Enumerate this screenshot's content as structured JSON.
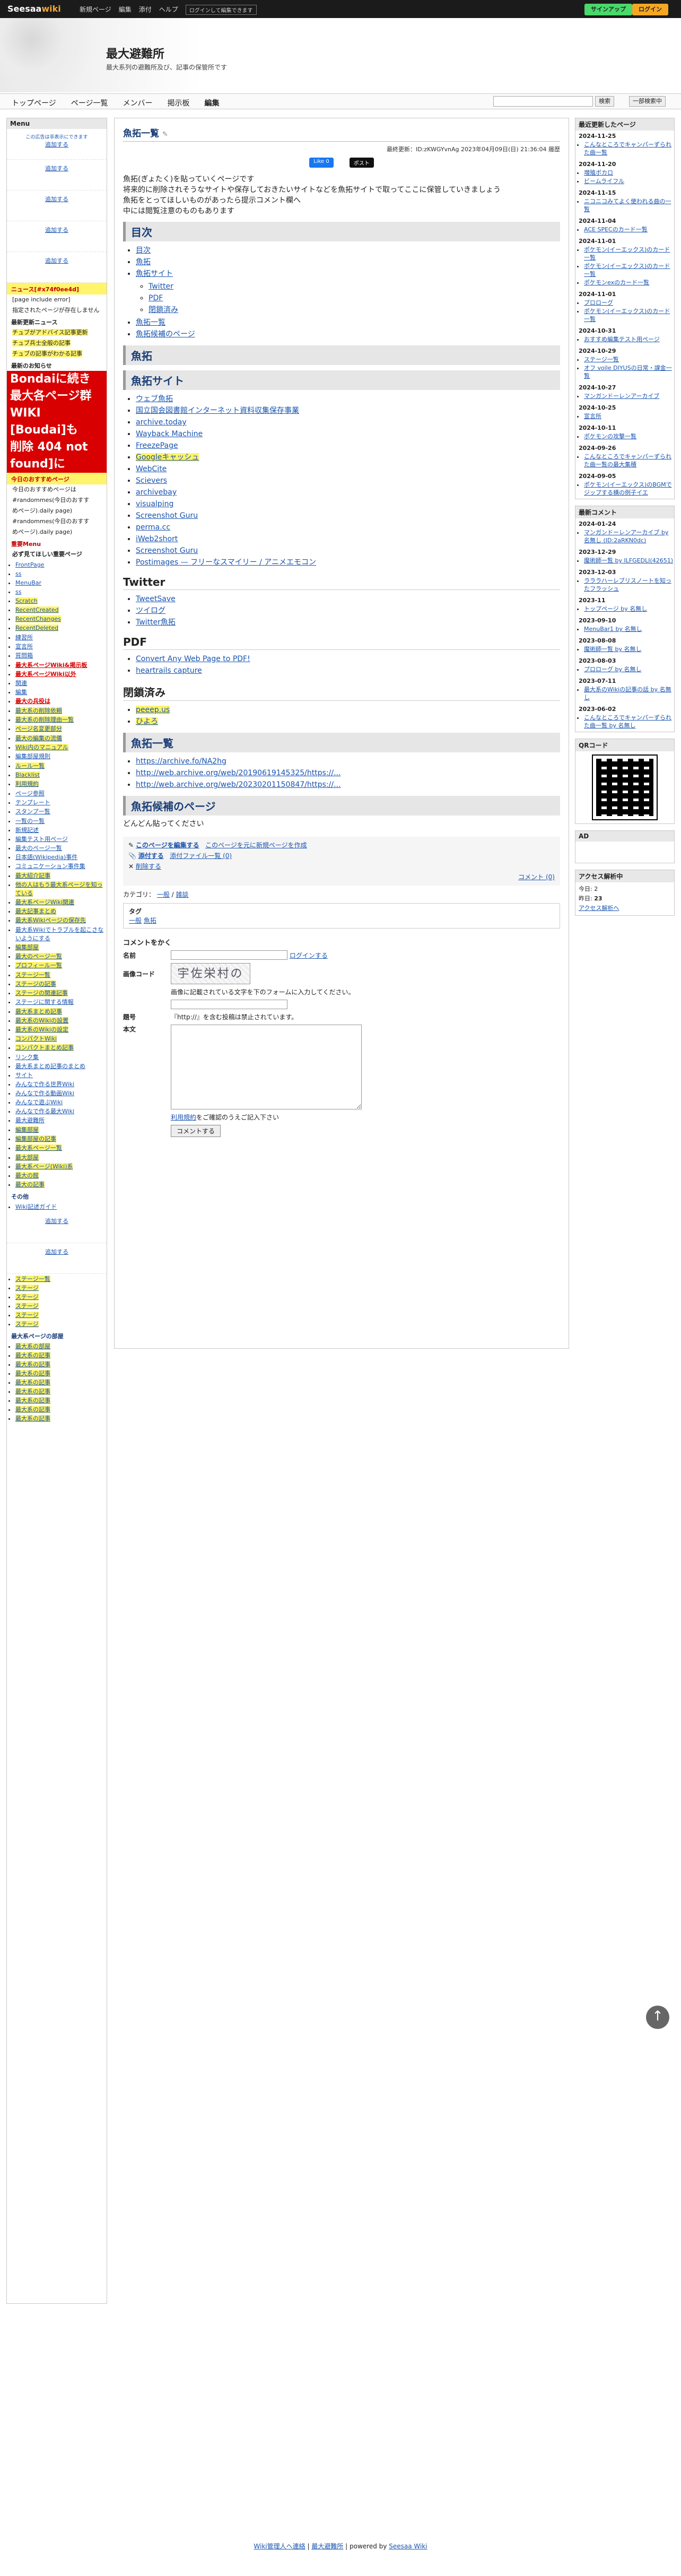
{
  "topbar": {
    "logo_main": "Seesaa",
    "logo_wiki": "wiki",
    "nav": [
      "新規ページ",
      "編集",
      "添付",
      "ヘルプ"
    ],
    "hint": "ログインして編集できます",
    "btn_signup": "サインアップ",
    "btn_login": "ログイン"
  },
  "header": {
    "title": "最大避難所",
    "subtitle": "最大系列の避難所及び、記事の保管所です"
  },
  "gnav": {
    "items": [
      "トップページ",
      "ページ一覧",
      "メンバー",
      "掲示板",
      "編集"
    ],
    "search_btn": "検索",
    "search_btn2": "一部検索中"
  },
  "left": {
    "menu_title": "Menu",
    "ad_text": "この広告は非表示にできます",
    "add_link": "追加する",
    "news_title": "ニュース[#x74f0ee4d]",
    "news_lines": [
      "[page include error]",
      "指定されたページが存在しません"
    ],
    "update_title": "最新更新ニュース",
    "yellow_lines": [
      "チュブがアドバイス記事更新",
      "チュブ兵士全般の記事",
      "チュブの記事がわかる記事"
    ],
    "notice_title": "最新のお知らせ",
    "red_big": [
      "Bondaiに続き",
      "最大各ページ群",
      "WIKI",
      "[Boudai]も",
      "削除 404 not",
      "found]に"
    ],
    "recommend_title": "今日のおすすめページ",
    "recommend": [
      "今日のおすすめページは",
      "#randommes(今日のおすす",
      "めページ).daily page)",
      "#randommes(今日のおすす",
      "めページ).daily page)"
    ],
    "important_title": "重要Menu",
    "important_sub": "必ず見てほしい重要ページ",
    "links1": [
      "FrontPage",
      "ss",
      "MenuBar",
      "ss",
      "Scratch",
      "RecentCreated",
      "RecentChanges",
      "RecentDeleted"
    ],
    "links2": [
      "練習所",
      "宣言所",
      "質問箱"
    ],
    "links3": [
      "最大系ページWiki&掲示板",
      "最大系ページWiki以外",
      "関連",
      "編集",
      "最大の兵役は"
    ],
    "links4": [
      "最大系の削除依頼",
      "最大系の削除理由一覧",
      "ページ名変更部分"
    ],
    "links5": [
      "最大の編集の流儀",
      "Wiki内のマニュアル",
      "編集部屋規則"
    ],
    "links6": [
      "ルール一覧",
      "Blacklist",
      "利用規約"
    ],
    "links7": [
      "ページ参照",
      "テンプレート",
      "スタンプ一覧"
    ],
    "links8": [
      "一覧の一覧",
      "新規記述",
      "編集テスト用ページ",
      "最大のページ一覧",
      "日本語(Wikipedia)事件",
      "コミュニケーション事件集"
    ],
    "links9": [
      "最大紹介記事",
      "他の人はもう最大系ページを知っている",
      "最大系ページWiki関連",
      "最大記事まとめ",
      "最大系Wikiページの保存先"
    ],
    "links10": [
      "最大系Wikiでトラブルを起こさないようにする",
      "編集部屋",
      "最大のページ一覧",
      "プロフィール一覧"
    ],
    "links11": [
      "ステージ一覧",
      "ステージの記事",
      "ステージの関連記事",
      "ステージに関する情報"
    ],
    "links12": [
      "最大系まとめ記事",
      "最大系のWikiの設置",
      "最大系のWikiの設定",
      "コンパクトWiki",
      "コンパクトまとめ記事"
    ],
    "links13": [
      "リンク集",
      "最大系まとめ記事のまとめ",
      "サイト",
      "みんなで作る世界Wiki",
      "みんなで作る動画Wiki",
      "みんなで遊ぶWiki",
      "みんなで作る最大Wiki",
      "最大避難所"
    ],
    "links14": [
      "編集部屋",
      "編集部屋の記事",
      "最大系ページ一覧"
    ],
    "links15": [
      "最大部屋",
      "最大系ページ(Wiki)系",
      "最大の館",
      "最大の記事"
    ],
    "others_title": "その他",
    "others": [
      "Wiki記述ガイド"
    ],
    "bottom_links": [
      "ステージ一覧",
      "ステージ",
      "ステージ",
      "ステージ",
      "ステージ",
      "ステージ"
    ],
    "bottom_title": "最大系ページの部屋",
    "bottom_links2": [
      "最大系の部屋",
      "最大系の記事",
      "最大系の記事",
      "最大系の記事",
      "最大系の記事",
      "最大系の記事",
      "最大系の記事",
      "最大系の記事",
      "最大系の記事"
    ]
  },
  "main": {
    "title": "魚拓一覧",
    "meta": "最終更新：ID:zKWGYvnAg 2023年04月09日(日) 21:36:04 履歴",
    "share_fb": "Like 0",
    "share_x": "ポスト",
    "intro": [
      "魚拓(ぎょたく)を貼っていくページです",
      "将来的に削除されそうなサイトや保存しておきたいサイトなどを魚拓サイトで取ってここに保管していきましょう",
      "魚拓をとってほしいものがあったら提示コメント欄へ",
      "中には閲覧注意のものもあります"
    ],
    "toc_title": "目次",
    "toc": [
      "目次",
      "魚拓",
      "魚拓サイト",
      "Twitter",
      "PDF",
      "閉鎖済み",
      "魚拓一覧",
      "魚拓候補のページ"
    ],
    "sec_gyotaku": "魚拓",
    "sec_sites": "魚拓サイト",
    "sites": [
      "ウェブ魚拓",
      "国立国会図書館インターネット資料収集保存事業",
      "archive.today",
      "Wayback Machine",
      "FreezePage",
      "Googleキャッシュ",
      "WebCite",
      "Scievers",
      "archivebay",
      "visualping",
      "Screenshot Guru",
      "perma.cc",
      "iWeb2short",
      "Screenshot Guru",
      "Postimages — フリーなスマイリー / アニメエモコン"
    ],
    "sec_twitter": "Twitter",
    "twitter": [
      "TweetSave",
      "ツイログ",
      "Twitter魚拓"
    ],
    "sec_pdf": "PDF",
    "pdf": [
      "Convert Any Web Page to PDF!",
      "heartrails capture"
    ],
    "sec_closed": "閉鎖済み",
    "closed": [
      "peeep.us",
      "ひよろ"
    ],
    "sec_list": "魚拓一覧",
    "list": [
      "https://archive.fo/NA2hg",
      "http://web.archive.org/web/20190619145325/https://...",
      "http://web.archive.org/web/20230201150847/https://..."
    ],
    "sec_candidate": "魚拓候補のページ",
    "candidate_text": "どんどん貼ってください",
    "edit_page": "このページを編集する",
    "edit_new": "このページを元に新規ページを作成",
    "add_to": "添付する",
    "add_count": "添付ファイル一覧 (0)",
    "delete": "削除する",
    "comment_count": "コメント (0)",
    "category_label": "カテゴリ：",
    "category_links": [
      "一般",
      "雑談"
    ],
    "tag_label": "タグ",
    "tag_values": [
      "一般",
      "魚拓"
    ],
    "comment_title": "コメントをかく",
    "name_label": "名前",
    "login_link": "ログインする",
    "captcha_label": "画像コード",
    "captcha_text": "画像に記載されている文字を下のフォームに入力してください。",
    "captcha_glyph": "宇佐栄村の",
    "url_label": "題号",
    "url_text": "『http://』を含む投稿は禁止されています。",
    "body_label": "本文",
    "rule_link": "利用規約",
    "rule_text": "をご確認のうえご記入下さい",
    "submit": "コメントする"
  },
  "right": {
    "recent_title": "最近更新したページ",
    "recent": [
      {
        "date": "2024-11-25",
        "items": [
          "こんなところでキャンパーずられた曲一覧"
        ]
      },
      {
        "date": "2024-11-20",
        "items": [
          "増殖ボカロ",
          "ビームライフル"
        ]
      },
      {
        "date": "2024-11-15",
        "items": [
          "ニコニコみてよく使われる曲の一覧"
        ]
      },
      {
        "date": "2024-11-04",
        "items": [
          "ACE SPECのカード一覧"
        ]
      },
      {
        "date": "2024-11-01",
        "items": [
          "ポケモン(イーエックス)のカード一覧",
          "ポケモン(イーエックス)のカード一覧",
          "ポケモンexのカード一覧"
        ]
      },
      {
        "date": "2024-11-01",
        "items": [
          "プロローグ",
          "ポケモン(イーエックス)のカード一覧"
        ]
      },
      {
        "date": "2024-10-31",
        "items": [
          "おすすめ編集テスト用ページ"
        ]
      },
      {
        "date": "2024-10-29",
        "items": [
          "ステージ一覧",
          "オフ voile DIYUSの日常・課金一覧"
        ]
      },
      {
        "date": "2024-10-27",
        "items": [
          "マンガンドーレンアーカイブ"
        ]
      },
      {
        "date": "2024-10-25",
        "items": [
          "宣言所"
        ]
      },
      {
        "date": "2024-10-11",
        "items": [
          "ポケモンの攻撃一覧"
        ]
      },
      {
        "date": "2024-09-26",
        "items": [
          "こんなところでキャンパーずられた曲一覧の最大集積"
        ]
      },
      {
        "date": "2024-09-05",
        "items": [
          "ポケモン(イーエックス)のBGMでジップする横の例子イエ"
        ]
      }
    ],
    "comment_title": "最新コメント",
    "comments": [
      {
        "date": "2024-01-24",
        "items": [
          "マンガンドーレンアーカイブ by 名無し (ID:2aRKN0dc)"
        ]
      },
      {
        "date": "2023-12-29",
        "items": [
          "魔術師一覧 by ILFGEDLI(42651)"
        ]
      },
      {
        "date": "2023-12-03",
        "items": [
          "ラララハーレブリスノートを知ったフラッシュ"
        ]
      },
      {
        "date": "2023-11",
        "items": [
          "トップページ by 名無し"
        ]
      },
      {
        "date": "2023-09-10",
        "items": [
          "MenuBar1 by 名無し"
        ]
      },
      {
        "date": "2023-08-08",
        "items": [
          "魔術師一覧 by 名無し"
        ]
      },
      {
        "date": "2023-08-03",
        "items": [
          "プロローグ by 名無し"
        ]
      },
      {
        "date": "2023-07-11",
        "items": [
          "最大系のWikiの記事の話 by 名無し"
        ]
      },
      {
        "date": "2023-06-02",
        "items": [
          "こんなところでキャンパーずられた曲一覧 by 名無し"
        ]
      }
    ],
    "qr_title": "QRコード",
    "ad_title": "AD",
    "access_title": "アクセス解析中",
    "today_label": "今日:",
    "today_value": "2",
    "yesterday_label": "昨日:",
    "yesterday_value": "23",
    "access_link": "アクセス解析へ"
  },
  "footer": {
    "text1": "Wiki管理人へ連絡",
    "text2": "最大避難所",
    "text3": "powered by",
    "text4": "Seesaa Wiki"
  },
  "colors": {
    "accent": "#1a3e78",
    "signup": "#4ad86a",
    "login": "#f5a623",
    "highlight": "#fff46a",
    "danger": "#d80000"
  }
}
